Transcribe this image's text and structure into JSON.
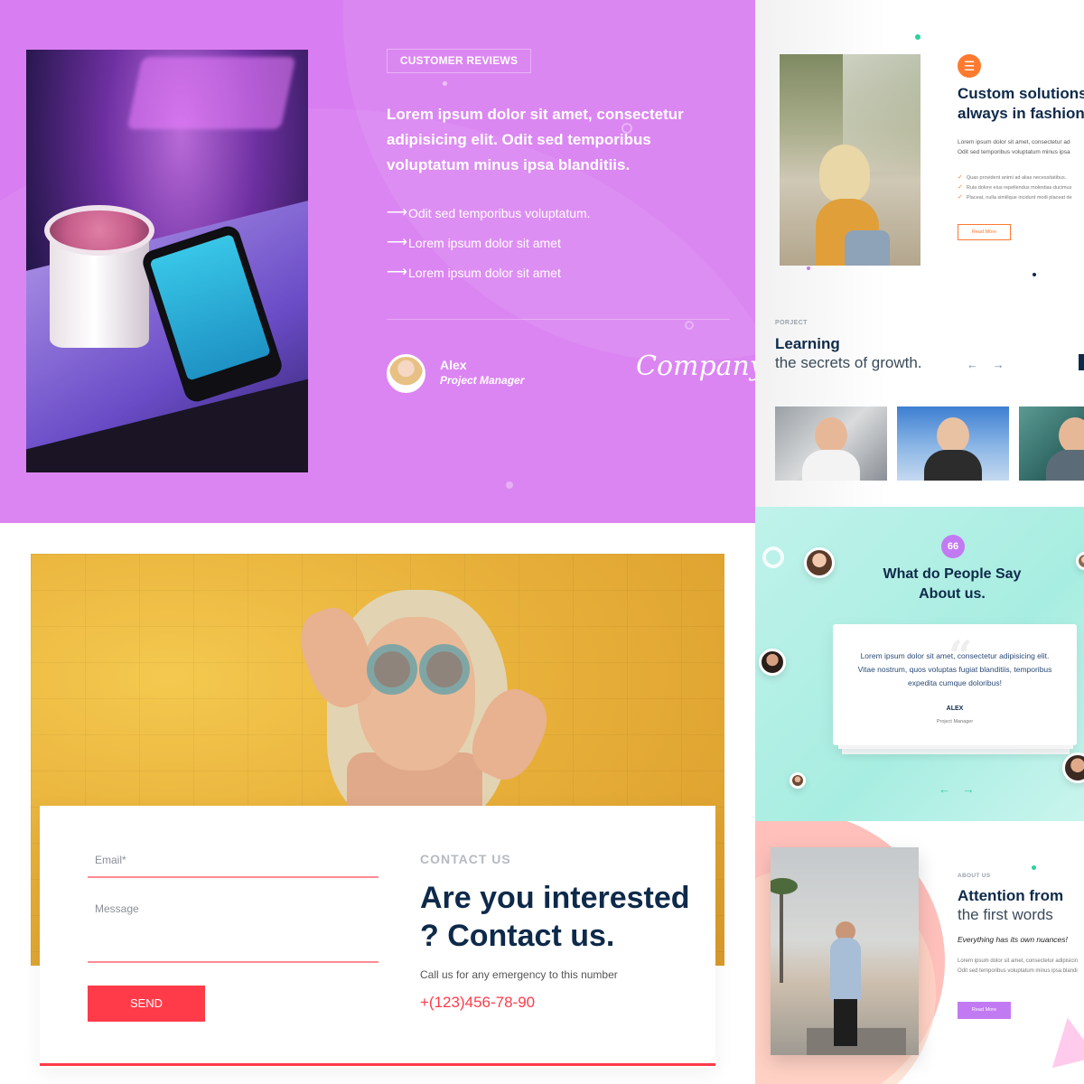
{
  "reviews": {
    "tag": "CUSTOMER REVIEWS",
    "headline": "Lorem ipsum dolor sit amet, consectetur adipisicing elit. Odit sed temporibus voluptatum minus ipsa blanditiis.",
    "bullets": [
      "Odit sed temporibus voluptatum.",
      "Lorem ipsum dolor sit amet",
      "Lorem ipsum dolor sit amet"
    ],
    "author": "Alex",
    "role": "Project Manager",
    "company": "Company",
    "bullet_icon": "arrow-right-icon",
    "accent": "#d97ef2"
  },
  "solutions": {
    "badge_icon": "list-icon",
    "title_line1": "Custom solutions",
    "title_line2": "always in fashion!",
    "para_line1": "Lorem ipsum dolor sit amet, consectetur ad",
    "para_line2": "Odit sed temporibus voluptatum minus ipsa",
    "checks": [
      "Quas provident animi ad alias necessitatibus.",
      "Ruia dolore eius repellendus molestias ducimus",
      "Placeat, nulla similique incidunt modi placeat de"
    ],
    "button": "Read More",
    "project_label": "PORJECT",
    "project_title": "Learning",
    "project_sub": "the secrets of growth.",
    "nav": "← →",
    "accent": "#ff7a2f"
  },
  "contact": {
    "email_placeholder": "Email*",
    "message_placeholder": "Message",
    "send": "SEND",
    "label": "CONTACT US",
    "title": "Are you interested ? Contact us.",
    "note": "Call us for any emergency to this number",
    "phone": "+(123)456-78-90",
    "accent": "#ff3b4a"
  },
  "people": {
    "icon": "quote-icon",
    "icon_text": "66",
    "title_line1": "What do People Say",
    "title_line2": "About us.",
    "quote": "Lorem ipsum dolor sit amet, consectetur adipisicing elit. Vitae nostrum, quos voluptas fugiat blanditiis, temporibus expedita cumque doloribus!",
    "name": "ALEX",
    "role": "Project Manager",
    "arrows": "← →",
    "accent": "#3ecaa8"
  },
  "about": {
    "label": "ABOUT US",
    "title_line1": "Attention from",
    "title_line2": "the first words",
    "tagline": "Everything has its own nuances!",
    "para_line1": "Lorem ipsum dolor sit amet, consectetur adipisicin",
    "para_line2": "Odit sed temporibus voluptatum minus ipsa blandi",
    "button": "Read More",
    "accent": "#c27af3"
  }
}
